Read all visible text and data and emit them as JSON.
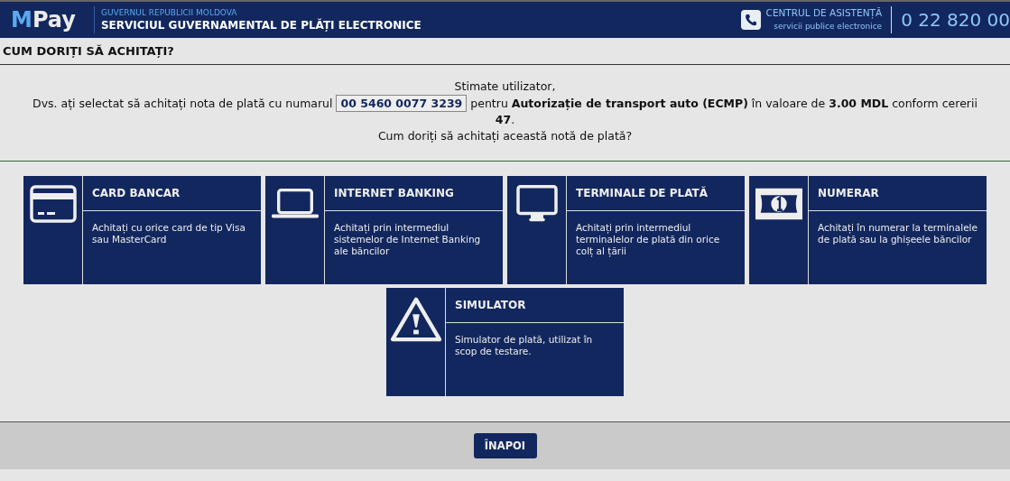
{
  "header": {
    "logo_first": "M",
    "logo_rest": "Pay",
    "government": "GUVERNUL REPUBLICII MOLDOVA",
    "service": "SERVICIUL GUVERNAMENTAL DE PLĂȚI ELECTRONICE",
    "help_title": "CENTRUL DE ASISTENȚĂ",
    "help_subtitle": "servicii publice electronice",
    "phone": "0 22 820 00"
  },
  "page_title": "CUM DORIȚI SĂ ACHITAȚI?",
  "message": {
    "greeting": "Stimate utilizator,",
    "text_before": "Dvs. ați selectat să achitați nota de plată cu numarul",
    "invoice_number": "00 5460 0077 3239",
    "text_after": "pentru **Autorizație de transport auto (ECMP)** în valoare de **3.00 MDL** conform cererii **47**.",
    "question": "Cum doriți să achitați această notă de plată?"
  },
  "payment_methods": [
    {
      "kind": "card",
      "title": "CARD BANCAR",
      "description": "Achitați cu orice card de tip Visa sau MasterCard"
    },
    {
      "kind": "laptop",
      "title": "INTERNET BANKING",
      "description": "Achitați prin intermediul sistemelor de Internet Banking ale băncilor"
    },
    {
      "kind": "monitor",
      "title": "TERMINALE DE PLATĂ",
      "description": "Achitați prin intermediul terminalelor de plată din orice colț al țării"
    },
    {
      "kind": "banknote",
      "title": "NUMERAR",
      "description": "Achitați în numerar la terminalele de plată sau la ghișeele băncilor"
    },
    {
      "kind": "warning",
      "title": "SIMULATOR",
      "description": "Simulator de plată, utilizat în scop de testare."
    }
  ],
  "back_button": "ÎNAPOI"
}
